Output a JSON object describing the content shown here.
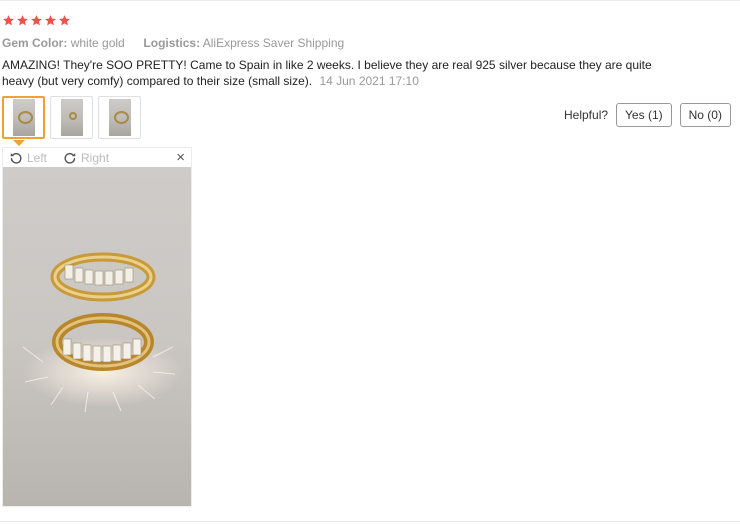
{
  "review": {
    "rating": 5,
    "star_color": "#f0514b",
    "meta": {
      "gem_color_label": "Gem Color:",
      "gem_color_value": "white gold",
      "logistics_label": "Logistics:",
      "logistics_value": "AliExpress Saver Shipping"
    },
    "text": "AMAZING! They're SOO PRETTY! Came to Spain in like 2 weeks. I believe they are real 925 silver because they are quite heavy (but very comfy) compared to their size (small size).",
    "date": "14 Jun 2021 17:10"
  },
  "thumbnails": [
    "photo-1",
    "photo-2",
    "photo-3"
  ],
  "helpful": {
    "label": "Helpful?",
    "yes_label": "Yes (1)",
    "no_label": "No (0)"
  },
  "viewer": {
    "rotate_left_label": "Left",
    "rotate_right_label": "Right",
    "close_label": "×",
    "rotate_left_icon": "rotate-left-icon",
    "rotate_right_icon": "rotate-right-icon",
    "close_icon": "close-icon"
  },
  "colors": {
    "accent": "#f0a132",
    "muted_text": "#999999"
  }
}
